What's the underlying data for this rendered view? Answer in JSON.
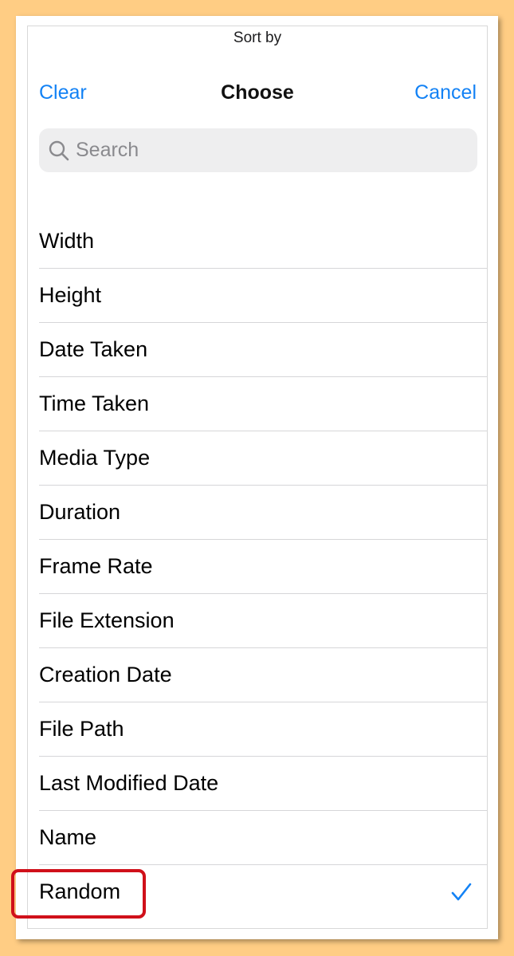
{
  "sheet": {
    "prompt": "Sort by"
  },
  "navbar": {
    "clear_label": "Clear",
    "title": "Choose",
    "cancel_label": "Cancel"
  },
  "search": {
    "placeholder": "Search",
    "value": "",
    "icon": "search-icon"
  },
  "options": {
    "items": [
      {
        "label": "Width",
        "selected": false
      },
      {
        "label": "Height",
        "selected": false
      },
      {
        "label": "Date Taken",
        "selected": false
      },
      {
        "label": "Time Taken",
        "selected": false
      },
      {
        "label": "Media Type",
        "selected": false
      },
      {
        "label": "Duration",
        "selected": false
      },
      {
        "label": "Frame Rate",
        "selected": false
      },
      {
        "label": "File Extension",
        "selected": false
      },
      {
        "label": "Creation Date",
        "selected": false
      },
      {
        "label": "File Path",
        "selected": false
      },
      {
        "label": "Last Modified Date",
        "selected": false
      },
      {
        "label": "Name",
        "selected": false
      },
      {
        "label": "Random",
        "selected": true
      }
    ],
    "selected_icon": "checkmark-icon"
  },
  "colors": {
    "accent": "#1382F5",
    "highlight": "#D0101A",
    "background": "#FFCD84"
  }
}
